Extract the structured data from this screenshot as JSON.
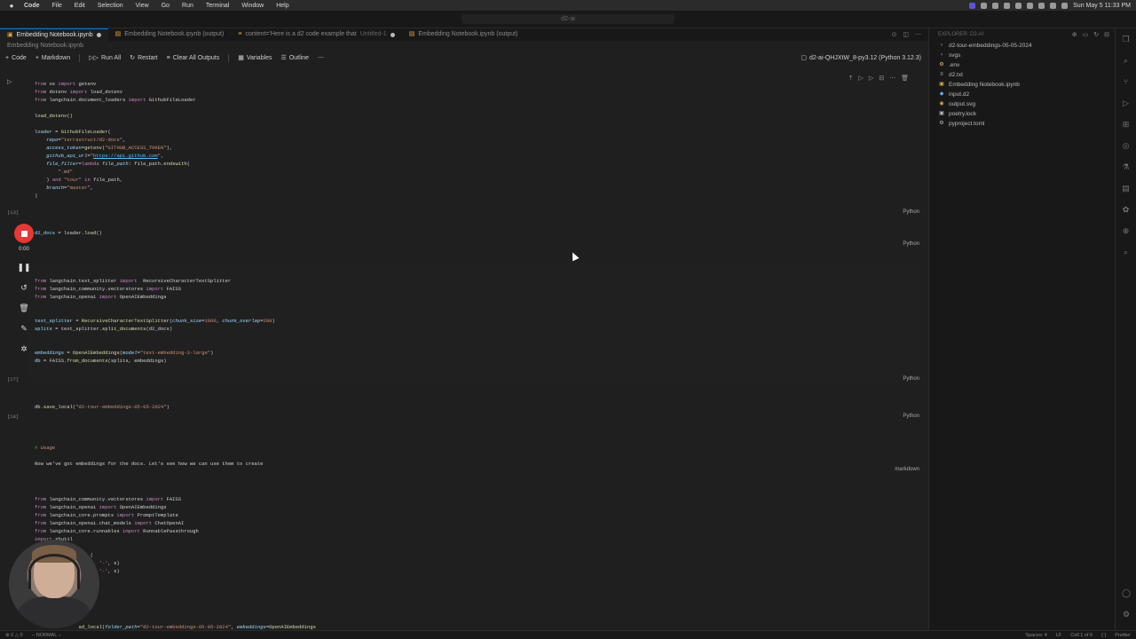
{
  "menubar": {
    "app": "Code",
    "items": [
      "File",
      "Edit",
      "Selection",
      "View",
      "Go",
      "Run",
      "Terminal",
      "Window",
      "Help"
    ],
    "clock": "Sun May 5  11:33 PM"
  },
  "titlebar": {
    "search": "d2-ai"
  },
  "tabs": [
    {
      "label": "Embedding Notebook.ipynb",
      "sub": "",
      "active": true,
      "dirty": true
    },
    {
      "label": "Embedding Notebook.ipynb (output)",
      "sub": "",
      "active": false,
      "dirty": false
    },
    {
      "label": "content='Here is a d2 code example that",
      "sub": "Untitled-1",
      "active": false,
      "dirty": true
    },
    {
      "label": "Embedding Notebook.ipynb (output)",
      "sub": "",
      "active": false,
      "dirty": false
    }
  ],
  "breadcrumb": "Embedding Notebook.ipynb",
  "toolbar": {
    "code": "Code",
    "markdown": "Markdown",
    "run_all": "Run All",
    "restart": "Restart",
    "clear": "Clear All Outputs",
    "variables": "Variables",
    "outline": "Outline",
    "kernel": "d2-ai-QHJXtW_8-py3.12 (Python 3.12.3)"
  },
  "cells": [
    {
      "count": "[13]",
      "lang": "Python"
    },
    {
      "count": "",
      "lang": "Python"
    },
    {
      "count": "[17]",
      "lang": "Python"
    },
    {
      "count": "[18]",
      "lang": "Python"
    },
    {
      "count": "",
      "lang": "markdown"
    },
    {
      "count": "",
      "lang": ""
    }
  ],
  "recorder": {
    "time": "0:00"
  },
  "explorer": {
    "header": "EXPLORER: D2-AI",
    "items": [
      {
        "name": "d2-tour-embeddings-05-05-2024",
        "icon": "folder-icon"
      },
      {
        "name": "svgs",
        "icon": "folder-icon"
      },
      {
        "name": ".env",
        "icon": "gear-icon"
      },
      {
        "name": "d2.txt",
        "icon": "file-icon"
      },
      {
        "name": "Embedding Notebook.ipynb",
        "icon": "notebook-icon"
      },
      {
        "name": "input.d2",
        "icon": "file-icon"
      },
      {
        "name": "output.svg",
        "icon": "image-icon"
      },
      {
        "name": "poetry.lock",
        "icon": "lock-icon"
      },
      {
        "name": "pyproject.toml",
        "icon": "file-icon"
      }
    ]
  },
  "statusbar": {
    "left": [
      "⊗ 0 △ 0",
      "-- NORMAL --"
    ],
    "right": [
      "Spaces: 4",
      "LF",
      "Cell 1 of 6",
      "{ }",
      "Prettier"
    ]
  }
}
